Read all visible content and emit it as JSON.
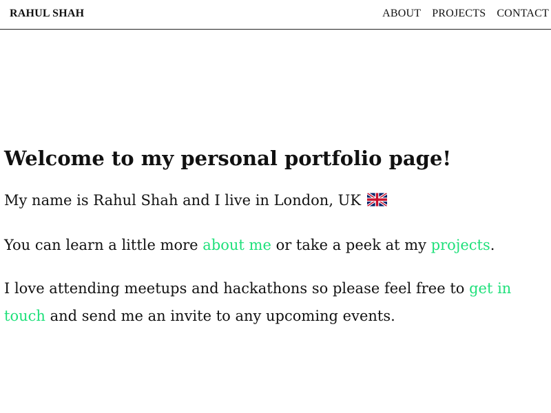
{
  "nav": {
    "brand": "RAHUL SHAH",
    "links": [
      "ABOUT",
      "PROJECTS",
      "CONTACT"
    ]
  },
  "main": {
    "heading": "Welcome to my personal portfolio page!",
    "intro": {
      "text": "My name is Rahul Shah and I live in London, UK",
      "flag_icon": "uk-flag-icon"
    },
    "learn_more": {
      "prefix": "You can learn a little more ",
      "about_link": "about me",
      "middle": " or take a peek at my ",
      "projects_link": "projects",
      "suffix": "."
    },
    "meetups": {
      "prefix": "I love attending meetups and hackathons so please feel free to ",
      "contact_link": "get in touch",
      "suffix": " and send me an invite to any upcoming events."
    }
  },
  "colors": {
    "link": "#1ee07a",
    "text": "#111111",
    "border": "#222222"
  }
}
